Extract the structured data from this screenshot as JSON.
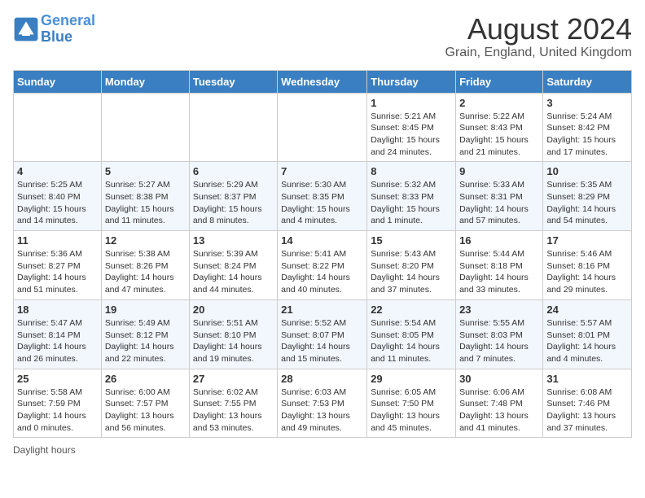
{
  "logo": {
    "text_general": "General",
    "text_blue": "Blue"
  },
  "header": {
    "title": "August 2024",
    "subtitle": "Grain, England, United Kingdom"
  },
  "weekdays": [
    "Sunday",
    "Monday",
    "Tuesday",
    "Wednesday",
    "Thursday",
    "Friday",
    "Saturday"
  ],
  "weeks": [
    [
      {
        "day": "",
        "info": ""
      },
      {
        "day": "",
        "info": ""
      },
      {
        "day": "",
        "info": ""
      },
      {
        "day": "",
        "info": ""
      },
      {
        "day": "1",
        "info": "Sunrise: 5:21 AM\nSunset: 8:45 PM\nDaylight: 15 hours\nand 24 minutes."
      },
      {
        "day": "2",
        "info": "Sunrise: 5:22 AM\nSunset: 8:43 PM\nDaylight: 15 hours\nand 21 minutes."
      },
      {
        "day": "3",
        "info": "Sunrise: 5:24 AM\nSunset: 8:42 PM\nDaylight: 15 hours\nand 17 minutes."
      }
    ],
    [
      {
        "day": "4",
        "info": "Sunrise: 5:25 AM\nSunset: 8:40 PM\nDaylight: 15 hours\nand 14 minutes."
      },
      {
        "day": "5",
        "info": "Sunrise: 5:27 AM\nSunset: 8:38 PM\nDaylight: 15 hours\nand 11 minutes."
      },
      {
        "day": "6",
        "info": "Sunrise: 5:29 AM\nSunset: 8:37 PM\nDaylight: 15 hours\nand 8 minutes."
      },
      {
        "day": "7",
        "info": "Sunrise: 5:30 AM\nSunset: 8:35 PM\nDaylight: 15 hours\nand 4 minutes."
      },
      {
        "day": "8",
        "info": "Sunrise: 5:32 AM\nSunset: 8:33 PM\nDaylight: 15 hours\nand 1 minute."
      },
      {
        "day": "9",
        "info": "Sunrise: 5:33 AM\nSunset: 8:31 PM\nDaylight: 14 hours\nand 57 minutes."
      },
      {
        "day": "10",
        "info": "Sunrise: 5:35 AM\nSunset: 8:29 PM\nDaylight: 14 hours\nand 54 minutes."
      }
    ],
    [
      {
        "day": "11",
        "info": "Sunrise: 5:36 AM\nSunset: 8:27 PM\nDaylight: 14 hours\nand 51 minutes."
      },
      {
        "day": "12",
        "info": "Sunrise: 5:38 AM\nSunset: 8:26 PM\nDaylight: 14 hours\nand 47 minutes."
      },
      {
        "day": "13",
        "info": "Sunrise: 5:39 AM\nSunset: 8:24 PM\nDaylight: 14 hours\nand 44 minutes."
      },
      {
        "day": "14",
        "info": "Sunrise: 5:41 AM\nSunset: 8:22 PM\nDaylight: 14 hours\nand 40 minutes."
      },
      {
        "day": "15",
        "info": "Sunrise: 5:43 AM\nSunset: 8:20 PM\nDaylight: 14 hours\nand 37 minutes."
      },
      {
        "day": "16",
        "info": "Sunrise: 5:44 AM\nSunset: 8:18 PM\nDaylight: 14 hours\nand 33 minutes."
      },
      {
        "day": "17",
        "info": "Sunrise: 5:46 AM\nSunset: 8:16 PM\nDaylight: 14 hours\nand 29 minutes."
      }
    ],
    [
      {
        "day": "18",
        "info": "Sunrise: 5:47 AM\nSunset: 8:14 PM\nDaylight: 14 hours\nand 26 minutes."
      },
      {
        "day": "19",
        "info": "Sunrise: 5:49 AM\nSunset: 8:12 PM\nDaylight: 14 hours\nand 22 minutes."
      },
      {
        "day": "20",
        "info": "Sunrise: 5:51 AM\nSunset: 8:10 PM\nDaylight: 14 hours\nand 19 minutes."
      },
      {
        "day": "21",
        "info": "Sunrise: 5:52 AM\nSunset: 8:07 PM\nDaylight: 14 hours\nand 15 minutes."
      },
      {
        "day": "22",
        "info": "Sunrise: 5:54 AM\nSunset: 8:05 PM\nDaylight: 14 hours\nand 11 minutes."
      },
      {
        "day": "23",
        "info": "Sunrise: 5:55 AM\nSunset: 8:03 PM\nDaylight: 14 hours\nand 7 minutes."
      },
      {
        "day": "24",
        "info": "Sunrise: 5:57 AM\nSunset: 8:01 PM\nDaylight: 14 hours\nand 4 minutes."
      }
    ],
    [
      {
        "day": "25",
        "info": "Sunrise: 5:58 AM\nSunset: 7:59 PM\nDaylight: 14 hours\nand 0 minutes."
      },
      {
        "day": "26",
        "info": "Sunrise: 6:00 AM\nSunset: 7:57 PM\nDaylight: 13 hours\nand 56 minutes."
      },
      {
        "day": "27",
        "info": "Sunrise: 6:02 AM\nSunset: 7:55 PM\nDaylight: 13 hours\nand 53 minutes."
      },
      {
        "day": "28",
        "info": "Sunrise: 6:03 AM\nSunset: 7:53 PM\nDaylight: 13 hours\nand 49 minutes."
      },
      {
        "day": "29",
        "info": "Sunrise: 6:05 AM\nSunset: 7:50 PM\nDaylight: 13 hours\nand 45 minutes."
      },
      {
        "day": "30",
        "info": "Sunrise: 6:06 AM\nSunset: 7:48 PM\nDaylight: 13 hours\nand 41 minutes."
      },
      {
        "day": "31",
        "info": "Sunrise: 6:08 AM\nSunset: 7:46 PM\nDaylight: 13 hours\nand 37 minutes."
      }
    ]
  ],
  "footer": {
    "note": "Daylight hours"
  }
}
